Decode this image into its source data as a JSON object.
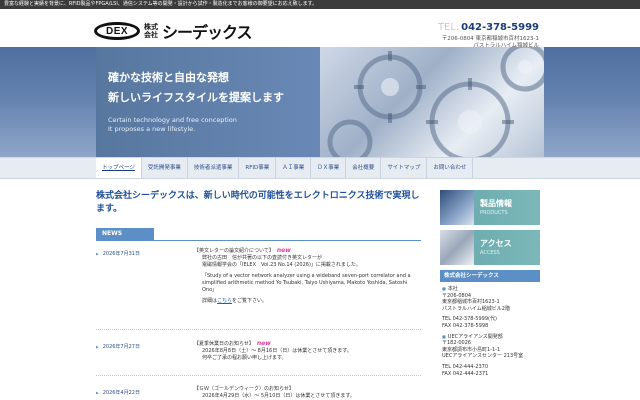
{
  "topbar": {
    "text": "豊富な経験と実績を背景に、RFID製品やFPGA/LSI、通信システム等の開発・設計から試作・製造化までお客様の御要望にお応え致します。"
  },
  "header": {
    "logo_mark": "DEX",
    "logo_kaisha": "株式会社",
    "logo_name": "シーデックス",
    "tel_label": "TEL.",
    "tel": "042-378-5999",
    "address_line1": "〒206-0804 東京都稲城市百村1623-1",
    "address_line2": "パストラルハイム稲城ビル"
  },
  "hero": {
    "title_line1": "確かな技術と自由な発想",
    "title_line2": "新しいライフスタイルを提案します",
    "en_line1": "Certain technology and free conception",
    "en_line2": "It proposes a new lifestyle."
  },
  "nav": {
    "items": [
      {
        "label": "トップページ"
      },
      {
        "label": "受託開発事業"
      },
      {
        "label": "技術者派遣事業"
      },
      {
        "label": "RFID事業"
      },
      {
        "label": "ＡＩ事業"
      },
      {
        "label": "ＤＸ事業"
      },
      {
        "label": "会社概要"
      },
      {
        "label": "サイトマップ"
      },
      {
        "label": "お問い合わせ"
      }
    ]
  },
  "main": {
    "headline": "株式会社シーデックスは、新しい時代の可能性をエレクトロニクス技術で実現します。",
    "news_label": "NEWS",
    "new_badge": "new",
    "news": [
      {
        "date": "2026年7月31日",
        "title": "【英文レターの論文紹介について】",
        "line1": "弊社の古田　信が共著の以下の査読付き英文レターが",
        "line2": "電磁情報学会の「IELEX　Vol.23 No.14 (2026)」に掲載されました。",
        "quote": "「Study of a vector network analyzer using a wideband seven-port correlator and a simplified arithmetic method Yo Tsubaki, Taiyo Ushiyama, Makoto Yoshida, Satoshi Ono」",
        "detail_prefix": "詳細は",
        "detail_link": "こちら",
        "detail_suffix": "をご覧下さい。"
      },
      {
        "date": "2026年7月27日",
        "title": "【夏季休業日のお知らせ】",
        "line1": "2026年8月8日（土）～ 8月16日（日）は休業とさせて頂きます。",
        "line2": "何卒ご了承の程お願い申し上げます。"
      },
      {
        "date": "2026年4月22日",
        "title": "【ＧＷ（ゴールデンウィーク）のお知らせ】",
        "line1": "2026年4月29日（水）～ 5月10日（日）は休業とさせて頂きます。"
      }
    ]
  },
  "sidebar": {
    "banners": [
      {
        "title": "製品情報",
        "sub": "PRODUCTS"
      },
      {
        "title": "アクセス",
        "sub": "ACCESS"
      }
    ],
    "company_heading": "株式会社シーデックス",
    "company_blocks": [
      {
        "label": "本社",
        "lines": [
          "〒206-0804",
          "東京都稲城市百村1623-1",
          "パストラルハイム稲城ビル2階"
        ]
      },
      {
        "label": "",
        "lines": [
          "TEL 042-378-5999(代)",
          "FAX 042-378-5998"
        ]
      },
      {
        "label": "UECアライアンス開発部",
        "lines": [
          "〒182-0026",
          "東京都調布市小島町1-1-1",
          "UECアライアンスセンター 213号室"
        ]
      },
      {
        "label": "",
        "lines": [
          "TEL 042-444-2370",
          "FAX 042-444-2371"
        ]
      }
    ]
  }
}
